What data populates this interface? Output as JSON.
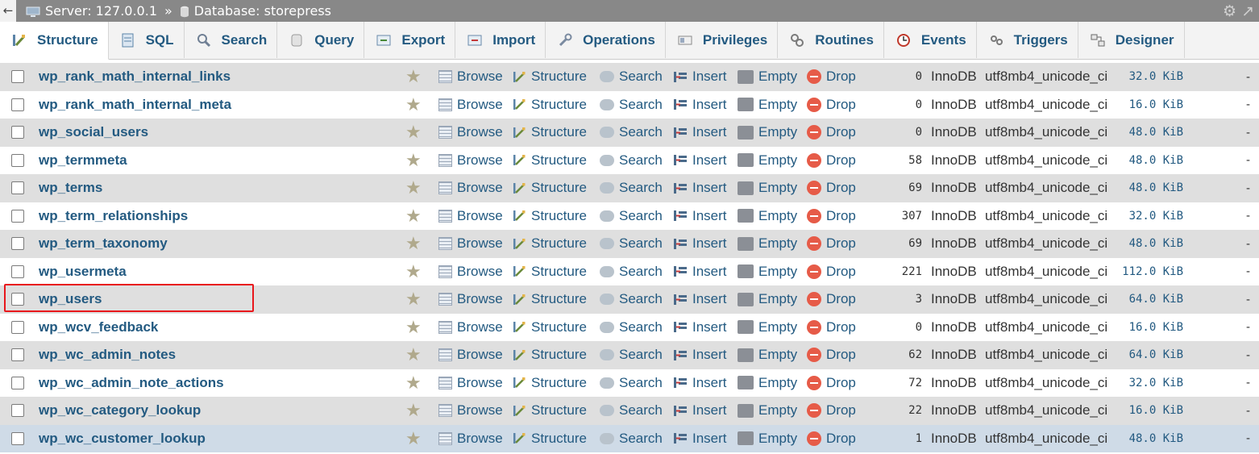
{
  "breadcrumb": {
    "back_glyph": "←",
    "server": "Server: 127.0.0.1",
    "separator": "»",
    "database": "Database: storepress"
  },
  "tabs": [
    {
      "label": "Structure",
      "icon": "structure-icon",
      "active": true
    },
    {
      "label": "SQL",
      "icon": "sql-icon"
    },
    {
      "label": "Search",
      "icon": "search-icon"
    },
    {
      "label": "Query",
      "icon": "query-icon"
    },
    {
      "label": "Export",
      "icon": "export-icon"
    },
    {
      "label": "Import",
      "icon": "import-icon"
    },
    {
      "label": "Operations",
      "icon": "wrench-icon"
    },
    {
      "label": "Privileges",
      "icon": "privileges-icon"
    },
    {
      "label": "Routines",
      "icon": "routines-icon"
    },
    {
      "label": "Events",
      "icon": "clock-icon"
    },
    {
      "label": "Triggers",
      "icon": "triggers-icon"
    },
    {
      "label": "Designer",
      "icon": "designer-icon"
    }
  ],
  "actions": {
    "browse": "Browse",
    "structure": "Structure",
    "search": "Search",
    "insert": "Insert",
    "empty": "Empty",
    "drop": "Drop"
  },
  "tables": [
    {
      "name": "wp_rank_math_internal_links",
      "rows": "0",
      "engine": "InnoDB",
      "collation": "utf8mb4_unicode_ci",
      "size": "32.0 KiB",
      "overhead": "-"
    },
    {
      "name": "wp_rank_math_internal_meta",
      "rows": "0",
      "engine": "InnoDB",
      "collation": "utf8mb4_unicode_ci",
      "size": "16.0 KiB",
      "overhead": "-"
    },
    {
      "name": "wp_social_users",
      "rows": "0",
      "engine": "InnoDB",
      "collation": "utf8mb4_unicode_ci",
      "size": "48.0 KiB",
      "overhead": "-"
    },
    {
      "name": "wp_termmeta",
      "rows": "58",
      "engine": "InnoDB",
      "collation": "utf8mb4_unicode_ci",
      "size": "48.0 KiB",
      "overhead": "-"
    },
    {
      "name": "wp_terms",
      "rows": "69",
      "engine": "InnoDB",
      "collation": "utf8mb4_unicode_ci",
      "size": "48.0 KiB",
      "overhead": "-"
    },
    {
      "name": "wp_term_relationships",
      "rows": "307",
      "engine": "InnoDB",
      "collation": "utf8mb4_unicode_ci",
      "size": "32.0 KiB",
      "overhead": "-"
    },
    {
      "name": "wp_term_taxonomy",
      "rows": "69",
      "engine": "InnoDB",
      "collation": "utf8mb4_unicode_ci",
      "size": "48.0 KiB",
      "overhead": "-"
    },
    {
      "name": "wp_usermeta",
      "rows": "221",
      "engine": "InnoDB",
      "collation": "utf8mb4_unicode_ci",
      "size": "112.0 KiB",
      "overhead": "-"
    },
    {
      "name": "wp_users",
      "rows": "3",
      "engine": "InnoDB",
      "collation": "utf8mb4_unicode_ci",
      "size": "64.0 KiB",
      "overhead": "-"
    },
    {
      "name": "wp_wcv_feedback",
      "rows": "0",
      "engine": "InnoDB",
      "collation": "utf8mb4_unicode_ci",
      "size": "16.0 KiB",
      "overhead": "-"
    },
    {
      "name": "wp_wc_admin_notes",
      "rows": "62",
      "engine": "InnoDB",
      "collation": "utf8mb4_unicode_ci",
      "size": "64.0 KiB",
      "overhead": "-"
    },
    {
      "name": "wp_wc_admin_note_actions",
      "rows": "72",
      "engine": "InnoDB",
      "collation": "utf8mb4_unicode_ci",
      "size": "32.0 KiB",
      "overhead": "-"
    },
    {
      "name": "wp_wc_category_lookup",
      "rows": "22",
      "engine": "InnoDB",
      "collation": "utf8mb4_unicode_ci",
      "size": "16.0 KiB",
      "overhead": "-"
    },
    {
      "name": "wp_wc_customer_lookup",
      "rows": "1",
      "engine": "InnoDB",
      "collation": "utf8mb4_unicode_ci",
      "size": "48.0 KiB",
      "overhead": "-"
    }
  ],
  "highlighted_table": "wp_users",
  "colors": {
    "link": "#235a81",
    "row_odd": "#dfdfdf",
    "row_hover": "#cfdbe7",
    "highlight_box": "#e8171c",
    "drop_icon": "#e65b48"
  }
}
